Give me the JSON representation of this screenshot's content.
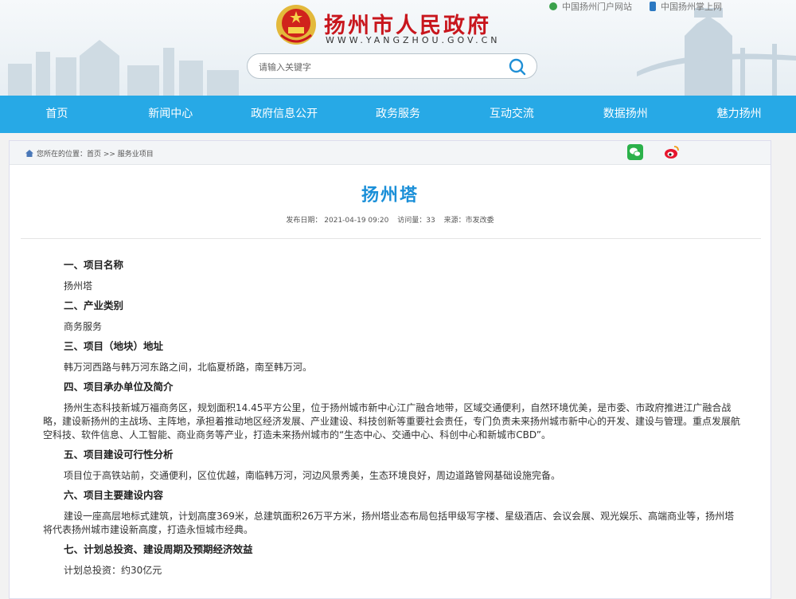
{
  "top_links": [
    "中国扬州门户网站",
    "中国扬州掌上网"
  ],
  "site": {
    "title": "扬州市人民政府",
    "url": "WWW.YANGZHOU.GOV.CN"
  },
  "search": {
    "placeholder": "请输入关键字"
  },
  "nav": [
    "首页",
    "新闻中心",
    "政府信息公开",
    "政务服务",
    "互动交流",
    "数据扬州",
    "魅力扬州"
  ],
  "breadcrumb": "您所在的位置：首页 >> 服务业项目",
  "article": {
    "title": "扬州塔",
    "meta": {
      "date": "发布日期： 2021-04-19 09:20",
      "views": "访问量：33",
      "source": "来源：市发改委"
    },
    "sections": [
      {
        "heading": "一、项目名称",
        "text": "扬州塔"
      },
      {
        "heading": "二、产业类别",
        "text": "商务服务"
      },
      {
        "heading": "三、项目（地块）地址",
        "text": "韩万河西路与韩万河东路之间，北临夏桥路，南至韩万河。"
      },
      {
        "heading": "四、项目承办单位及简介",
        "text": "扬州生态科技新城万福商务区，规划面积14.45平方公里，位于扬州城市新中心江广融合地带，区域交通便利，自然环境优美，是市委、市政府推进江广融合战略，建设新扬州的主战场、主阵地，承担着推动地区经济发展、产业建设、科技创新等重要社会责任，专门负责未来扬州城市新中心的开发、建设与管理。重点发展航空科技、软件信息、人工智能、商业商务等产业，打造未来扬州城市的“生态中心、交通中心、科创中心和新城市CBD”。"
      },
      {
        "heading": "五、项目建设可行性分析",
        "text": "项目位于高铁站前，交通便利，区位优越，南临韩万河，河边风景秀美，生态环境良好，周边道路管网基础设施完备。"
      },
      {
        "heading": "六、项目主要建设内容",
        "text": "建设一座高层地标式建筑，计划高度369米，总建筑面积26万平方米，扬州塔业态布局包括甲级写字楼、星级酒店、会议会展、观光娱乐、高端商业等，扬州塔将代表扬州城市建设新高度，打造永恒城市经典。"
      },
      {
        "heading": "七、计划总投资、建设周期及预期经济效益",
        "text": "计划总投资：约30亿元"
      }
    ]
  },
  "colors": {
    "nav_bg": "#27a9e6",
    "title_red": "#c8161d",
    "article_title": "#1a8fd8"
  }
}
